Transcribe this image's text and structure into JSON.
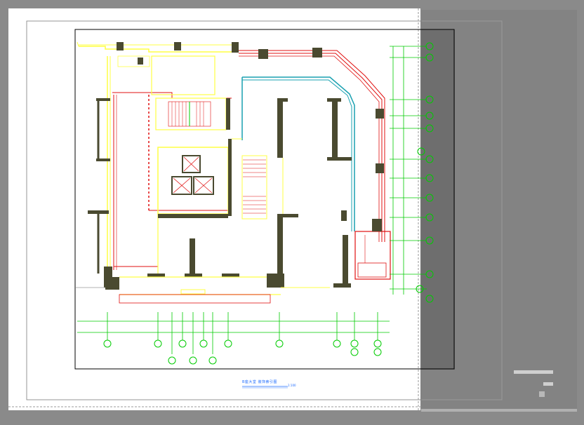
{
  "drawing": {
    "title": "B座大堂  装饰索引图",
    "scale": "1:100",
    "colors": {
      "background": "#8a8a8a",
      "sheet": "#ffffff",
      "wall": "#ffff44",
      "wall_fill": "#4a4a30",
      "red_line": "#e01010",
      "cyan_line": "#18a0b0",
      "dim_green": "#00cc00",
      "grid_bubble": "#00cc00",
      "title_blue": "#1e6cff"
    },
    "icons": [
      "elevator-icon",
      "stair-icon",
      "grid-bubble-icon",
      "column-icon"
    ]
  }
}
